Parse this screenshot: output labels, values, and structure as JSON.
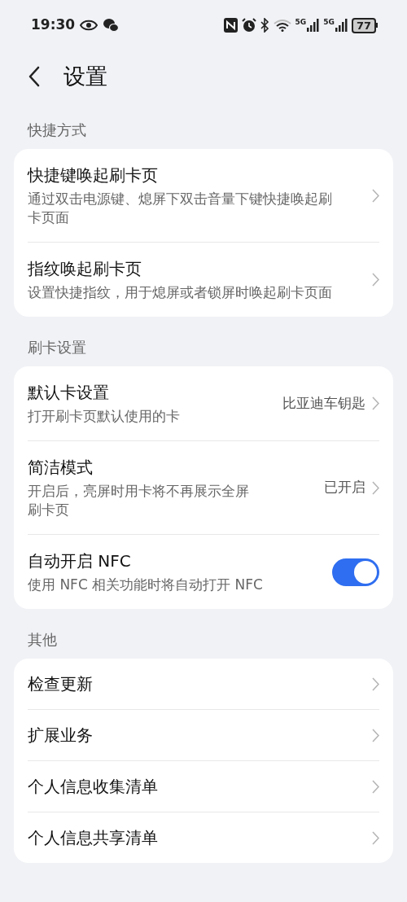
{
  "status_bar": {
    "time": "19:30",
    "battery": "77",
    "network_labels": [
      "5G",
      "5G"
    ]
  },
  "header": {
    "title": "设置"
  },
  "sections": [
    {
      "title": "快捷方式",
      "items": [
        {
          "kind": "link",
          "title": "快捷键唤起刷卡页",
          "subtitle": "通过双击电源键、熄屏下双击音量下键快捷唤起刷卡页面"
        },
        {
          "kind": "link",
          "title": "指纹唤起刷卡页",
          "subtitle": "设置快捷指纹，用于熄屏或者锁屏时唤起刷卡页面"
        }
      ]
    },
    {
      "title": "刷卡设置",
      "items": [
        {
          "kind": "link",
          "title": "默认卡设置",
          "subtitle": "打开刷卡页默认使用的卡",
          "value": "比亚迪车钥匙"
        },
        {
          "kind": "link",
          "title": "简洁模式",
          "subtitle": "开启后，亮屏时用卡将不再展示全屏刷卡页",
          "value": "已开启"
        },
        {
          "kind": "toggle",
          "title": "自动开启 NFC",
          "subtitle": "使用 NFC 相关功能时将自动打开 NFC",
          "on": true
        }
      ]
    },
    {
      "title": "其他",
      "items": [
        {
          "kind": "link",
          "title": "检查更新"
        },
        {
          "kind": "link",
          "title": "扩展业务"
        },
        {
          "kind": "link",
          "title": "个人信息收集清单"
        },
        {
          "kind": "link",
          "title": "个人信息共享清单"
        }
      ]
    }
  ]
}
